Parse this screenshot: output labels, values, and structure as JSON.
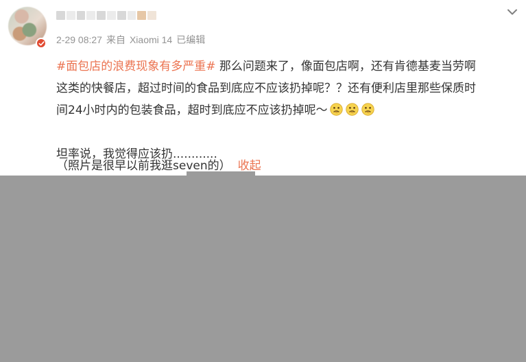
{
  "post": {
    "timestamp": "2-29 08:27",
    "source_prefix": "来自",
    "source_device": "Xiaomi 14",
    "edited_label": "已编辑",
    "hashtag": "#面包店的浪费现象有多严重#",
    "body_line1_after_hashtag": " 那么问题来了，像面包店啊，还有肯德基麦当劳啊",
    "body_line2": "这类的快餐店，超过时间的食品到底应不应该扔掉呢？？还有便利店里那些保质时",
    "body_line3": "间24小时内的包装食品，超时到底应不应该扔掉呢～",
    "paragraph2": "坦率说，我觉得应该扔............",
    "paragraph3": "（照片是很早以前我逛seven的）",
    "collapse_label": "收起",
    "emoji_names": [
      "thinking-face-icon",
      "thinking-face-icon",
      "thinking-face-icon"
    ]
  },
  "colors": {
    "hashtag": "#eb7350",
    "meta_text": "#939393",
    "overlay": "#9b9b9b"
  }
}
